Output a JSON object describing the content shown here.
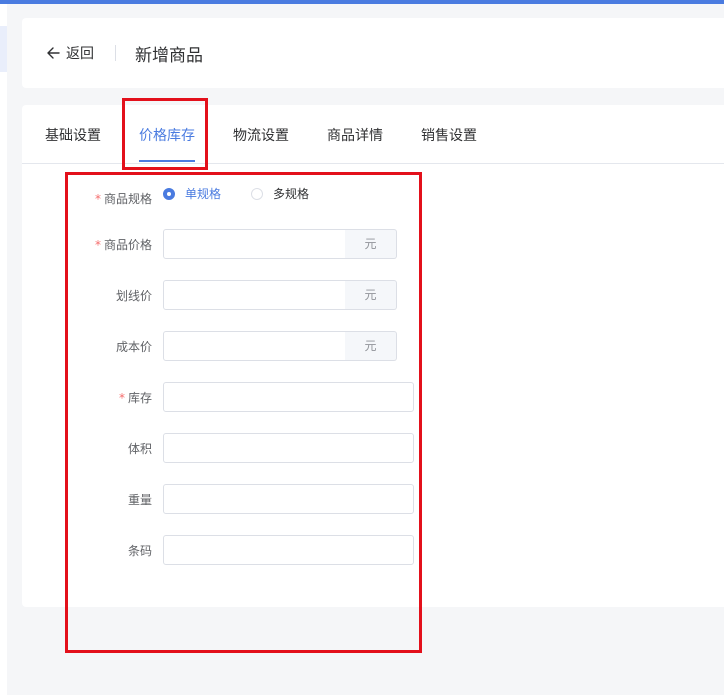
{
  "header": {
    "back_label": "返回",
    "title": "新增商品"
  },
  "tabs": [
    {
      "label": "基础设置",
      "active": false
    },
    {
      "label": "价格库存",
      "active": true
    },
    {
      "label": "物流设置",
      "active": false
    },
    {
      "label": "商品详情",
      "active": false
    },
    {
      "label": "销售设置",
      "active": false
    }
  ],
  "form": {
    "spec": {
      "label": "商品规格",
      "required": true,
      "options": [
        {
          "label": "单规格",
          "selected": true
        },
        {
          "label": "多规格",
          "selected": false
        }
      ]
    },
    "price": {
      "label": "商品价格",
      "required": true,
      "value": "",
      "suffix": "元"
    },
    "original_price": {
      "label": "划线价",
      "value": "",
      "suffix": "元"
    },
    "cost_price": {
      "label": "成本价",
      "value": "",
      "suffix": "元"
    },
    "stock": {
      "label": "库存",
      "required": true,
      "value": ""
    },
    "volume": {
      "label": "体积",
      "value": ""
    },
    "weight": {
      "label": "重量",
      "value": ""
    },
    "barcode": {
      "label": "条码",
      "value": ""
    }
  },
  "colors": {
    "accent": "#4a7be0",
    "required_mark": "#f56c6c",
    "highlight_box": "#e3101b"
  },
  "required_mark": "*"
}
